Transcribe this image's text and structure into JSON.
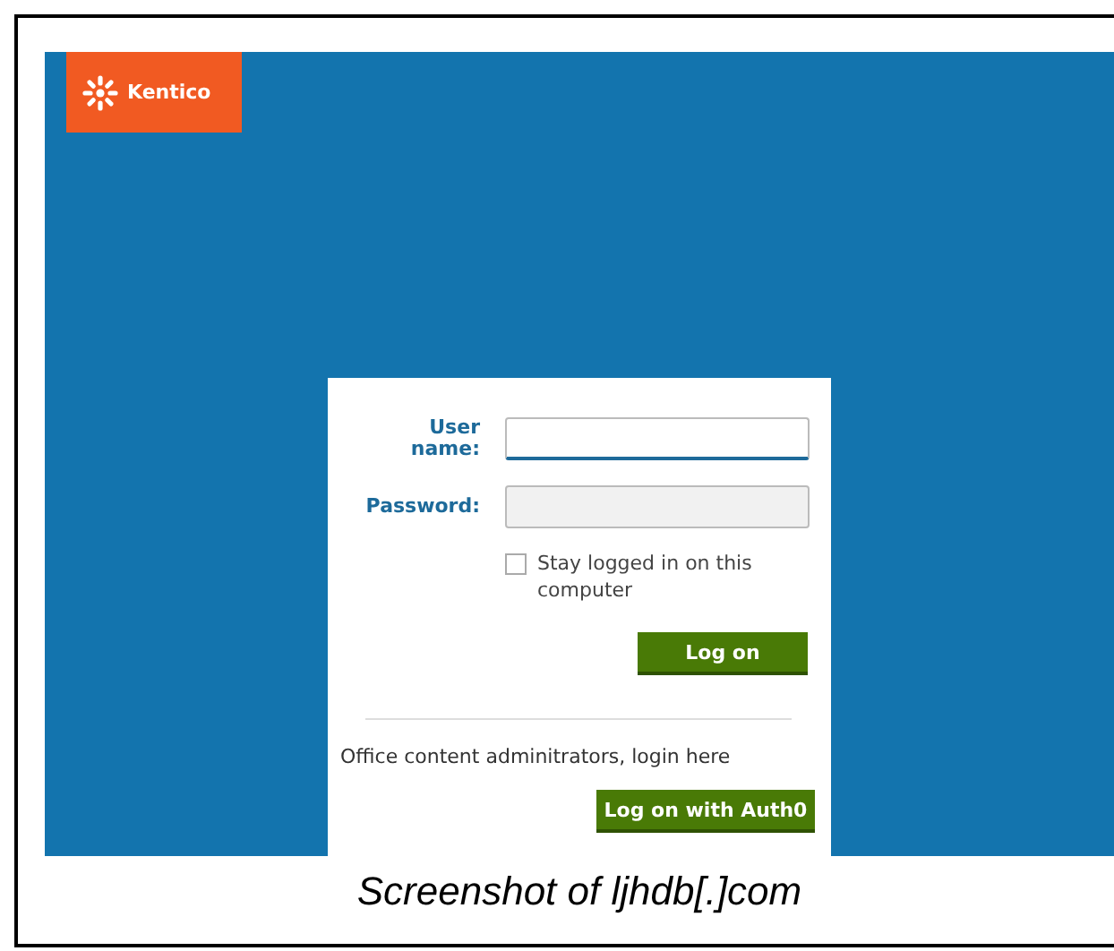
{
  "logo": {
    "text": "Kentico"
  },
  "login_form": {
    "username": {
      "label": "User name:"
    },
    "password": {
      "label": "Password:"
    },
    "stay_logged_in": {
      "label": "Stay logged in on this computer",
      "checked": false
    },
    "log_on_button": "Log on",
    "admin_text": "Office content adminitrators, login here",
    "auth0_button": "Log on with Auth0"
  },
  "caption": "Screenshot of ljhdb[.]com"
}
